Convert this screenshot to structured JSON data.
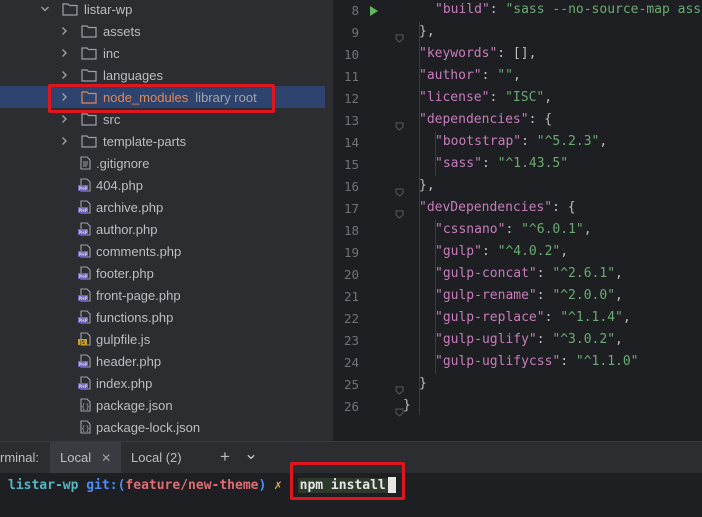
{
  "project_tree": {
    "root": "listar-wp",
    "folders": [
      {
        "name": "assets"
      },
      {
        "name": "inc"
      },
      {
        "name": "languages"
      },
      {
        "name": "node_modules",
        "annotation": "library root"
      },
      {
        "name": "src"
      },
      {
        "name": "template-parts"
      }
    ],
    "files": [
      {
        "name": ".gitignore",
        "icon": "text-file-icon"
      },
      {
        "name": "404.php",
        "icon": "php-file-icon"
      },
      {
        "name": "archive.php",
        "icon": "php-file-icon"
      },
      {
        "name": "author.php",
        "icon": "php-file-icon"
      },
      {
        "name": "comments.php",
        "icon": "php-file-icon"
      },
      {
        "name": "footer.php",
        "icon": "php-file-icon"
      },
      {
        "name": "front-page.php",
        "icon": "php-file-icon"
      },
      {
        "name": "functions.php",
        "icon": "php-file-icon"
      },
      {
        "name": "gulpfile.js",
        "icon": "js-file-icon"
      },
      {
        "name": "header.php",
        "icon": "php-file-icon"
      },
      {
        "name": "index.php",
        "icon": "php-file-icon"
      },
      {
        "name": "package.json",
        "icon": "json-file-icon"
      },
      {
        "name": "package-lock.json",
        "icon": "json-file-icon"
      }
    ]
  },
  "editor": {
    "lines": [
      {
        "n": "8",
        "code": [
          [
            "k",
            "\"build\""
          ],
          [
            "p",
            ": "
          ],
          [
            "s",
            "\"sass --no-source-map ass"
          ]
        ]
      },
      {
        "n": "9",
        "code": [
          [
            "p",
            "},"
          ]
        ]
      },
      {
        "n": "10",
        "code": [
          [
            "k",
            "\"keywords\""
          ],
          [
            "p",
            ": [],"
          ]
        ]
      },
      {
        "n": "11",
        "code": [
          [
            "k",
            "\"author\""
          ],
          [
            "p",
            ": "
          ],
          [
            "s",
            "\"\""
          ],
          [
            "p",
            ","
          ]
        ]
      },
      {
        "n": "12",
        "code": [
          [
            "k",
            "\"license\""
          ],
          [
            "p",
            ": "
          ],
          [
            "s",
            "\"ISC\""
          ],
          [
            "p",
            ","
          ]
        ]
      },
      {
        "n": "13",
        "code": [
          [
            "k",
            "\"dependencies\""
          ],
          [
            "p",
            ": {"
          ]
        ]
      },
      {
        "n": "14",
        "code": [
          [
            "k",
            "\"bootstrap\""
          ],
          [
            "p",
            ": "
          ],
          [
            "s",
            "\"^5.2.3\""
          ],
          [
            "p",
            ","
          ]
        ]
      },
      {
        "n": "15",
        "code": [
          [
            "k",
            "\"sass\""
          ],
          [
            "p",
            ": "
          ],
          [
            "s",
            "\"^1.43.5\""
          ]
        ]
      },
      {
        "n": "16",
        "code": [
          [
            "p",
            "},"
          ]
        ]
      },
      {
        "n": "17",
        "code": [
          [
            "k",
            "\"devDependencies\""
          ],
          [
            "p",
            ": {"
          ]
        ]
      },
      {
        "n": "18",
        "code": [
          [
            "k",
            "\"cssnano\""
          ],
          [
            "p",
            ": "
          ],
          [
            "s",
            "\"^6.0.1\""
          ],
          [
            "p",
            ","
          ]
        ]
      },
      {
        "n": "19",
        "code": [
          [
            "k",
            "\"gulp\""
          ],
          [
            "p",
            ": "
          ],
          [
            "s",
            "\"^4.0.2\""
          ],
          [
            "p",
            ","
          ]
        ]
      },
      {
        "n": "20",
        "code": [
          [
            "k",
            "\"gulp-concat\""
          ],
          [
            "p",
            ": "
          ],
          [
            "s",
            "\"^2.6.1\""
          ],
          [
            "p",
            ","
          ]
        ]
      },
      {
        "n": "21",
        "code": [
          [
            "k",
            "\"gulp-rename\""
          ],
          [
            "p",
            ": "
          ],
          [
            "s",
            "\"^2.0.0\""
          ],
          [
            "p",
            ","
          ]
        ]
      },
      {
        "n": "22",
        "code": [
          [
            "k",
            "\"gulp-replace\""
          ],
          [
            "p",
            ": "
          ],
          [
            "s",
            "\"^1.1.4\""
          ],
          [
            "p",
            ","
          ]
        ]
      },
      {
        "n": "23",
        "code": [
          [
            "k",
            "\"gulp-uglify\""
          ],
          [
            "p",
            ": "
          ],
          [
            "s",
            "\"^3.0.2\""
          ],
          [
            "p",
            ","
          ]
        ]
      },
      {
        "n": "24",
        "code": [
          [
            "k",
            "\"gulp-uglifycss\""
          ],
          [
            "p",
            ": "
          ],
          [
            "s",
            "\"^1.1.0\""
          ]
        ]
      },
      {
        "n": "25",
        "code": [
          [
            "p",
            "}"
          ]
        ]
      },
      {
        "n": "26",
        "code": [
          [
            "p",
            "}"
          ]
        ]
      }
    ]
  },
  "terminal": {
    "title": "rminal:",
    "tabs": [
      {
        "label": "Local",
        "active": true
      },
      {
        "label": "Local (2)",
        "active": false
      }
    ],
    "add_label": "+",
    "menu_label": "⌄",
    "prompt": {
      "dir": "listar-wp",
      "git": "git:(",
      "branch": "feature/new-theme",
      "git_close": ")",
      "mark": "✗",
      "command": "npm install"
    }
  }
}
